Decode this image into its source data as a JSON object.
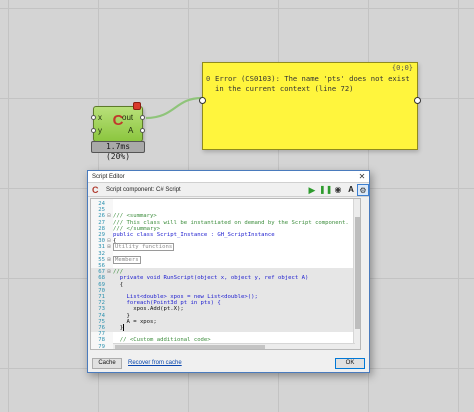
{
  "canvas": {
    "component": {
      "input_x": "x",
      "input_y": "y",
      "input_a": "A",
      "output": "out",
      "timer": "1.7ms (20%)"
    },
    "panel": {
      "header": "{0;0}",
      "index": "0",
      "message": "Error (CS0103): The name 'pts' does not exist in the current context (line 72)"
    }
  },
  "window": {
    "title": "Script Editor",
    "close_glyph": "✕",
    "toolbar": {
      "title": "Script component: C# Script",
      "run_icon": "run-icon",
      "pause_icon": "pause-icon",
      "preview_icon": "eye-icon",
      "font_label": "A",
      "settings_icon": "gear-icon"
    },
    "editor": {
      "lines": [
        {
          "n": "24",
          "fold": "",
          "text": ""
        },
        {
          "n": "25",
          "fold": "",
          "text": ""
        },
        {
          "n": "26",
          "fold": "⊟",
          "text": "/// <summary>"
        },
        {
          "n": "27",
          "fold": "",
          "text": "/// This class will be instantiated on demand by the Script component."
        },
        {
          "n": "28",
          "fold": "",
          "text": "/// </summary>"
        },
        {
          "n": "29",
          "fold": "",
          "text": "public class Script_Instance : GH_ScriptInstance"
        },
        {
          "n": "30",
          "fold": "⊟",
          "text": "{"
        },
        {
          "n": "31",
          "fold": "⊞",
          "text": "Utility functions"
        },
        {
          "n": "32",
          "fold": "",
          "text": ""
        },
        {
          "n": "55",
          "fold": "⊞",
          "text": "Members"
        },
        {
          "n": "56",
          "fold": "",
          "text": ""
        },
        {
          "n": "67",
          "fold": "⊞",
          "text": "///"
        },
        {
          "n": "68",
          "fold": "",
          "text": "  private void RunScript(object x, object y, ref object A)"
        },
        {
          "n": "69",
          "fold": "",
          "text": "  {"
        },
        {
          "n": "70",
          "fold": "",
          "text": ""
        },
        {
          "n": "71",
          "fold": "",
          "text": "    List<double> xpos = new List<double>();"
        },
        {
          "n": "72",
          "fold": "",
          "text": "    foreach(Point3d pt in pts) {"
        },
        {
          "n": "73",
          "fold": "",
          "text": "      xpos.Add(pt.X);"
        },
        {
          "n": "74",
          "fold": "",
          "text": "    }"
        },
        {
          "n": "75",
          "fold": "",
          "text": "    A = xpos;"
        },
        {
          "n": "76",
          "fold": "",
          "text": "  }"
        },
        {
          "n": "77",
          "fold": "",
          "text": ""
        },
        {
          "n": "78",
          "fold": "",
          "text": "  // <Custom additional code>"
        },
        {
          "n": "79",
          "fold": "",
          "text": ""
        }
      ]
    },
    "buttons": {
      "cache": "Cache",
      "recover": "Recover from cache",
      "ok": "OK"
    }
  }
}
